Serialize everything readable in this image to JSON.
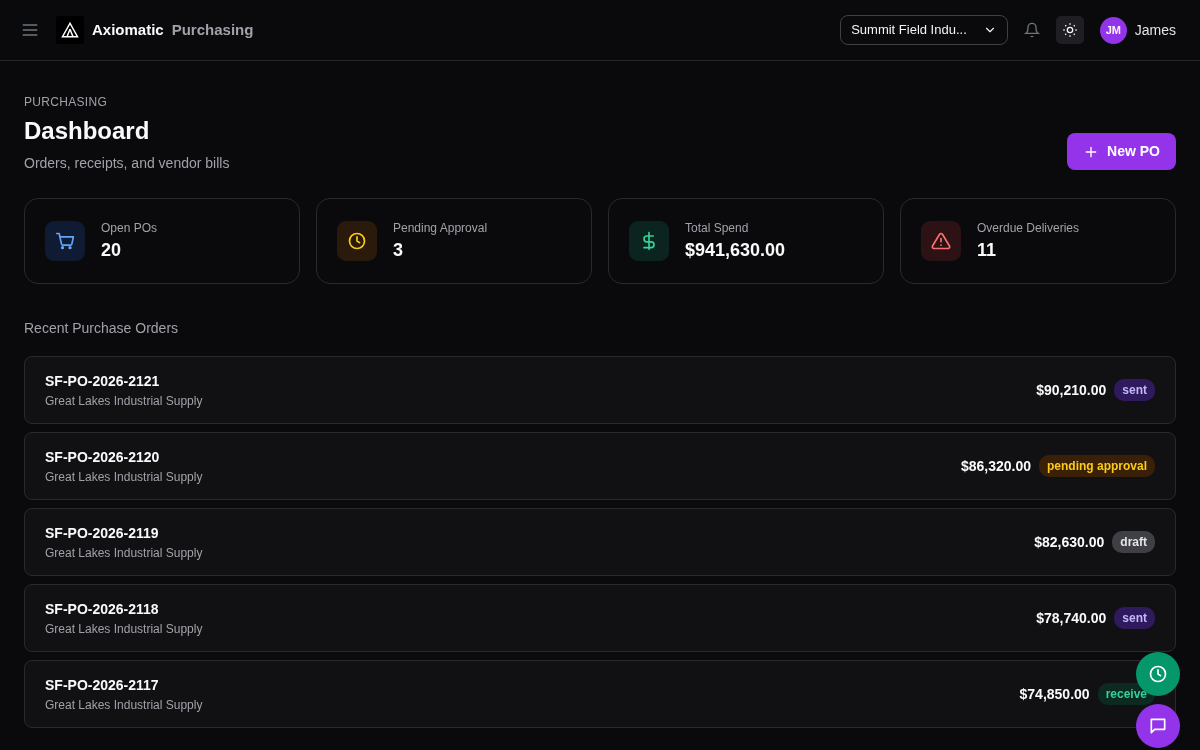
{
  "header": {
    "brand": "Axiomatic",
    "product": "Purchasing",
    "company": "Summit Field Indu...",
    "user_initials": "JM",
    "user_name": "James"
  },
  "page": {
    "eyebrow": "PURCHASING",
    "title": "Dashboard",
    "subtitle": "Orders, receipts, and vendor bills",
    "new_button": "New PO"
  },
  "stats": [
    {
      "kind": "cart",
      "label": "Open POs",
      "value": "20"
    },
    {
      "kind": "clock",
      "label": "Pending Approval",
      "value": "3"
    },
    {
      "kind": "dollar",
      "label": "Total Spend",
      "value": "$941,630.00"
    },
    {
      "kind": "warning",
      "label": "Overdue Deliveries",
      "value": "11"
    }
  ],
  "recent": {
    "title": "Recent Purchase Orders",
    "orders": [
      {
        "number": "SF-PO-2026-2121",
        "vendor": "Great Lakes Industrial Supply",
        "amount": "$90,210.00",
        "status": "sent",
        "kind": "sent"
      },
      {
        "number": "SF-PO-2026-2120",
        "vendor": "Great Lakes Industrial Supply",
        "amount": "$86,320.00",
        "status": "pending approval",
        "kind": "pending"
      },
      {
        "number": "SF-PO-2026-2119",
        "vendor": "Great Lakes Industrial Supply",
        "amount": "$82,630.00",
        "status": "draft",
        "kind": "draft"
      },
      {
        "number": "SF-PO-2026-2118",
        "vendor": "Great Lakes Industrial Supply",
        "amount": "$78,740.00",
        "status": "sent",
        "kind": "sent"
      },
      {
        "number": "SF-PO-2026-2117",
        "vendor": "Great Lakes Industrial Supply",
        "amount": "$74,850.00",
        "status": "receive",
        "kind": "received"
      }
    ]
  }
}
